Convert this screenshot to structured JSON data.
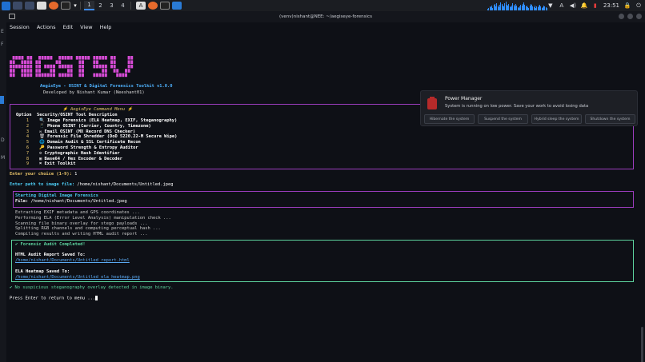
{
  "panel": {
    "workspaces": [
      "1",
      "2",
      "3",
      "4"
    ],
    "clock": "23:51",
    "icons": [
      "kali-menu-icon",
      "show-desktop-icon",
      "file-manager-icon",
      "text-editor-icon",
      "firefox-icon",
      "terminal-icon",
      "app-icon",
      "firefox-icon",
      "terminal-icon",
      "window-icon"
    ]
  },
  "window": {
    "title": "(venv)nishant@NEE: ~/aegiseye-forensics",
    "menu": [
      "Session",
      "Actions",
      "Edit",
      "View",
      "Help"
    ]
  },
  "banner": {
    "title": "AegisEye - OSINT & Digital Forensics Toolkit v1.0.0",
    "author": "Developed by Nishant Kumar (Neeshant01)"
  },
  "command_menu": {
    "title": "⚡ AegisEye Command Menu ⚡",
    "col_option": "Option",
    "col_desc": "Security/OSINT Tool Description",
    "items": [
      {
        "num": "1",
        "icon": "🔍",
        "label": "Image Forensics (ELA Heatmap, EXIF, Steganography)"
      },
      {
        "num": "2",
        "icon": "📱",
        "label": "Phone OSINT (Carrier, Country, Timezone)"
      },
      {
        "num": "3",
        "icon": "✉",
        "label": "Email OSINT (MX Record DNS Checker)"
      },
      {
        "num": "4",
        "icon": "🗑",
        "label": "Forensic File Shredder (DoD 5220.22-M Secure Wipe)"
      },
      {
        "num": "5",
        "icon": "🌐",
        "label": "Domain Audit & SSL Certificate Recon"
      },
      {
        "num": "6",
        "icon": "🔑",
        "label": "Password Strength & Entropy Auditor"
      },
      {
        "num": "7",
        "icon": "⚙",
        "label": "Cryptographic Hash Identifier"
      },
      {
        "num": "8",
        "icon": "▣",
        "label": "Base64 / Hex Encoder & Decoder"
      },
      {
        "num": "9",
        "icon": "✖",
        "label": "Exit Toolkit"
      }
    ]
  },
  "prompts": {
    "choice_label": "Enter your choice (1-9):",
    "choice_value": " 1",
    "path_label": "Enter path to image file:",
    "path_value": " /home/nishant/Documents/Untitled.jpeg"
  },
  "forensics": {
    "heading": "Starting Digital Image Forensics",
    "file_label": "File:",
    "file_value": " /home/nishant/Documents/Untitled.jpeg",
    "steps": [
      "Extracting EXIF metadata and GPS coordinates ...",
      "Performing ELA (Error Level Analysis) manipulation check ...",
      "Scanning file binary overlay for stego payloads ...",
      "Splitting RGB channels and computing perceptual hash ...",
      "Compiling results and writing HTML audit report ..."
    ]
  },
  "results": {
    "completed": "✔ Forensic Audit Completed!",
    "html_label": "HTML Audit Report Saved To:",
    "html_path": "/home/nishant/Documents/Untitled_report.html",
    "ela_label": "ELA Heatmap Saved To:",
    "ela_path": "/home/nishant/Documents/Untitled_ela_heatmap.png",
    "stego": "✔ No suspicious steganography overlay detected in image binary.",
    "press_enter": "Press Enter to return to menu ..."
  },
  "notification": {
    "title": "Power Manager",
    "body": "System is running on low power. Save your work to avoid losing data",
    "buttons": [
      "Hibernate the system",
      "Suspend the system",
      "Hybrid sleep the system",
      "Shutdown the system"
    ]
  },
  "colors": {
    "accent_purple": "#9b3dbd",
    "accent_green": "#5dd39e",
    "prompt_yellow": "#e9c46a",
    "heading_cyan": "#4cc9f0",
    "banner_magenta": "#d64bd6"
  }
}
